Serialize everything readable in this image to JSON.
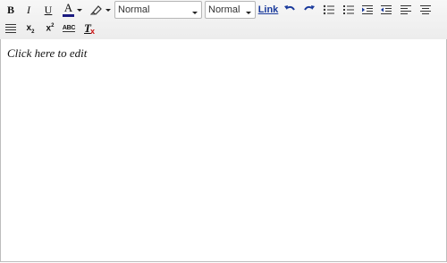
{
  "toolbar": {
    "bold_label": "B",
    "italic_label": "I",
    "underline_label": "U",
    "text_color_label": "A",
    "text_color_value": "#1a1a80",
    "format_select": {
      "selected": "Normal"
    },
    "font_select": {
      "selected": "Normal"
    },
    "link_label": "Link",
    "subscript_label": "x",
    "subscript_mark": "2",
    "superscript_label": "x",
    "superscript_mark": "2",
    "spellcheck_label": "ABC",
    "clear_format_label": "T",
    "clear_format_mark": "x",
    "icons": [
      "bold-icon",
      "italic-icon",
      "underline-icon",
      "text-color-icon",
      "highlight-icon",
      "undo-icon",
      "redo-icon",
      "bullet-list-icon",
      "numbered-list-icon",
      "indent-icon",
      "outdent-icon",
      "align-left-icon",
      "align-center-icon",
      "align-justify-icon",
      "subscript-icon",
      "superscript-icon",
      "spellcheck-icon",
      "clear-format-icon"
    ],
    "accent_color": "#1a3a9c",
    "clear_format_mark_color": "#cc1111"
  },
  "editor": {
    "text": "Click here to edit"
  }
}
